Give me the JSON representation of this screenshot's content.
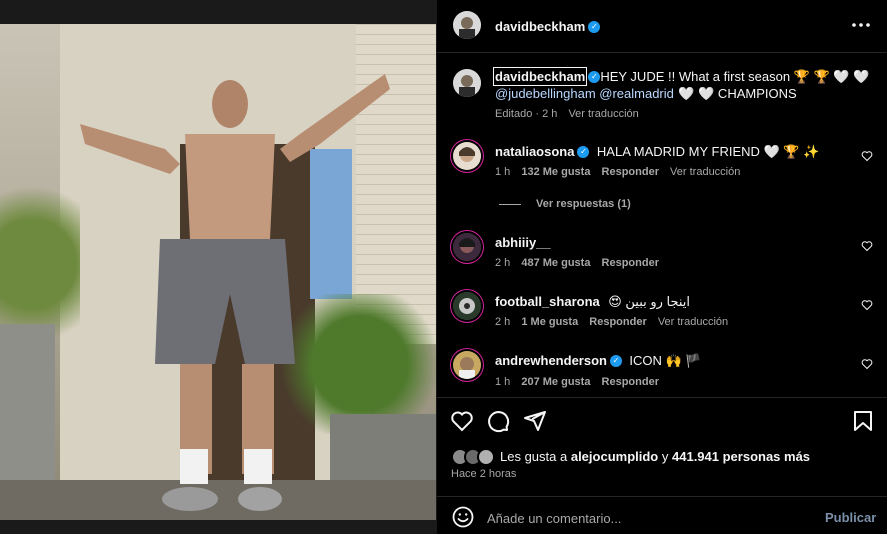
{
  "post": {
    "author": "davidbeckham",
    "caption_mention": "davidbeckham",
    "caption_text": "HEY JUDE !! What a first season 🏆 🏆  🤍  🤍",
    "caption_tags": "@judebellingham @realmadrid",
    "caption_text2": "🤍 🤍  CHAMPIONS",
    "caption_meta": "Editado · 2 h",
    "caption_translate": "Ver traducción"
  },
  "comments": [
    {
      "user": "nataliaosona",
      "verified": true,
      "text": "HALA MADRID MY FRIEND 🤍 🏆 ✨",
      "time": "1 h",
      "likes": "132 Me gusta",
      "reply": "Responder",
      "translate": "Ver traducción",
      "replies": "Ver respuestas (1)"
    },
    {
      "user": "abhiiiy__",
      "verified": false,
      "text": "",
      "time": "2 h",
      "likes": "487 Me gusta",
      "reply": "Responder"
    },
    {
      "user": "football_sharona",
      "verified": false,
      "text": "😍 اینجا رو ببین",
      "time": "2 h",
      "likes": "1 Me gusta",
      "reply": "Responder",
      "translate": "Ver traducción"
    },
    {
      "user": "andrewhenderson",
      "verified": true,
      "text": "ICON 🙌 🏴",
      "time": "1 h",
      "likes": "207 Me gusta",
      "reply": "Responder"
    }
  ],
  "likes": {
    "prefix": "Les gusta a",
    "user": "alejocumplido",
    "mid": "y",
    "count": "441.941 personas más",
    "posted": "Hace 2 horas"
  },
  "composer": {
    "placeholder": "Añade un comentario...",
    "publish": "Publicar"
  },
  "icons": {
    "more": "more-horizontal-icon",
    "like": "heart-icon",
    "comment": "comment-icon",
    "share": "send-icon",
    "save": "bookmark-icon",
    "emoji": "emoji-icon"
  },
  "colors": {
    "verified": "#1d9bf0",
    "link": "#e0f1ff",
    "publish": "#7a8fa8"
  }
}
